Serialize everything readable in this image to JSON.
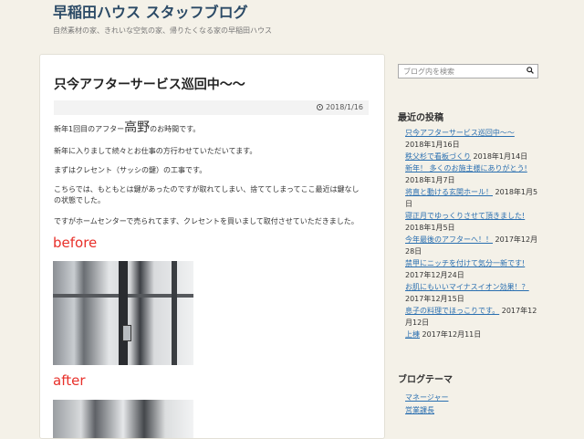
{
  "header": {
    "site_title": "早稲田ハウス スタッフブログ",
    "site_description": "自然素材の家、きれいな空気の家、帰りたくなる家の早稲田ハウス"
  },
  "post": {
    "title": "只今アフターサービス巡回中～～",
    "date": "2018/1/16",
    "p1_prefix": "新年1回目のアフター",
    "p1_name": "高野",
    "p1_suffix": "のお時間です。",
    "p2": "新年に入りまして続々とお仕事の方行わせていただいてます。",
    "p3": "まずはクレセント（サッシの鍵）の工事です。",
    "p4_line1": "こちらでは、もともとは鍵があったのですが取れてしまい、捨ててしまってここ最近は鍵なし",
    "p4_line2": "の状態でした。",
    "p5": "ですがホームセンターで売られてます、クレセントを買いまして取付させていただきました。",
    "label_before": "before",
    "label_after": "after"
  },
  "sidebar": {
    "search_placeholder": "ブログ内を検索",
    "recent_title": "最近の投稿",
    "recent_posts": [
      {
        "title": "只今アフターサービス巡回中～～",
        "date": "2018年1月16日"
      },
      {
        "title": "秩父杉で看板づくり",
        "date": "2018年1月14日"
      },
      {
        "title": "新年！ 多くのお施主様にありがとう!",
        "date": "2018年1月7日"
      },
      {
        "title": "将直と動ける玄関ホール！",
        "date": "2018年1月5日"
      },
      {
        "title": "寝正月でゆっくりさせて頂きました!",
        "date": "2018年1月5日"
      },
      {
        "title": "今年最後のアフターへ！！",
        "date": "2017年12月28日"
      },
      {
        "title": "禁甲にニッチを付けて気分一新です!",
        "date": "2017年12月24日"
      },
      {
        "title": "お肌にもいいマイナスイオン効果！？",
        "date": "2017年12月15日"
      },
      {
        "title": "息子の料理でほっこりです。",
        "date": "2017年12月12日"
      },
      {
        "title": "上棟",
        "date": "2017年12月11日"
      }
    ],
    "theme_title": "ブログテーマ",
    "themes": [
      "マネージャー",
      "営業課長"
    ]
  },
  "colors": {
    "background": "#f4f1e8",
    "link": "#2a6fb0",
    "accent_red": "#e8302a",
    "title": "#2b4a66"
  }
}
